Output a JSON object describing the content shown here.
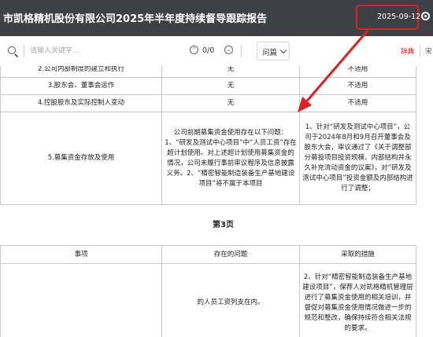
{
  "header": {
    "title": "市凯格精机股份有限公司2025年半年度持续督导跟踪报告",
    "date": "2025-09-12",
    "accent_color": "#e02020"
  },
  "toolbar": {
    "search_placeholder": "请输入关键字...",
    "match_count": "0/0",
    "question_label": "问篇",
    "dict_label": "辞典",
    "extra_label": "宋"
  },
  "table1": {
    "rows": [
      {
        "item": "2.公司内部制度的建立和执行",
        "status": "无",
        "measure": "不适用"
      },
      {
        "item": "3.股东会、董事会运作",
        "status": "无",
        "measure": "不适用"
      },
      {
        "item": "4.控股股东及实际控制人变动",
        "status": "无",
        "measure": "不适用"
      },
      {
        "item": "5.募集资金存放及使用",
        "status": "公司前期募集资金使用存在以下问题：1、“研发及测试中心项目”中“人员工资”存在超计划使用。对上述超计划使用募集资金的情况，公司未履行事前审议程序及信息披露义务。2、“精密智能制造装备生产基地建设项目”将不属于本项目",
        "measure": "1、针对“研发及测试中心项目”，公司于2024年8月和9月召开董事会及股东大会，审议通过了《关于调整部分募投项目投资规模、内部结构并永久补充流动资金的议案》，对“研发及测试中心项目”投资金额及内部结构进行了调整；"
      }
    ]
  },
  "page_label": "第3页",
  "table2": {
    "headers": [
      "事项",
      "存在的问题",
      "采取的措施"
    ],
    "row": {
      "item": "",
      "status": "的人员工资列支在内。",
      "measure": "2、针对“精密智能制造装备生产基地建设项目”，保荐人对凯格精机管理层进行了募集资金使用的相关培训，并督促对募集资金使用情况做进一步的规范和整改，确保持续符合相关法规的要求。"
    }
  },
  "icons": {
    "search": "search-icon",
    "prev": "chevron-up-icon",
    "next": "chevron-down-icon",
    "settings": "gear-icon",
    "annotation": "arrow-icon"
  }
}
